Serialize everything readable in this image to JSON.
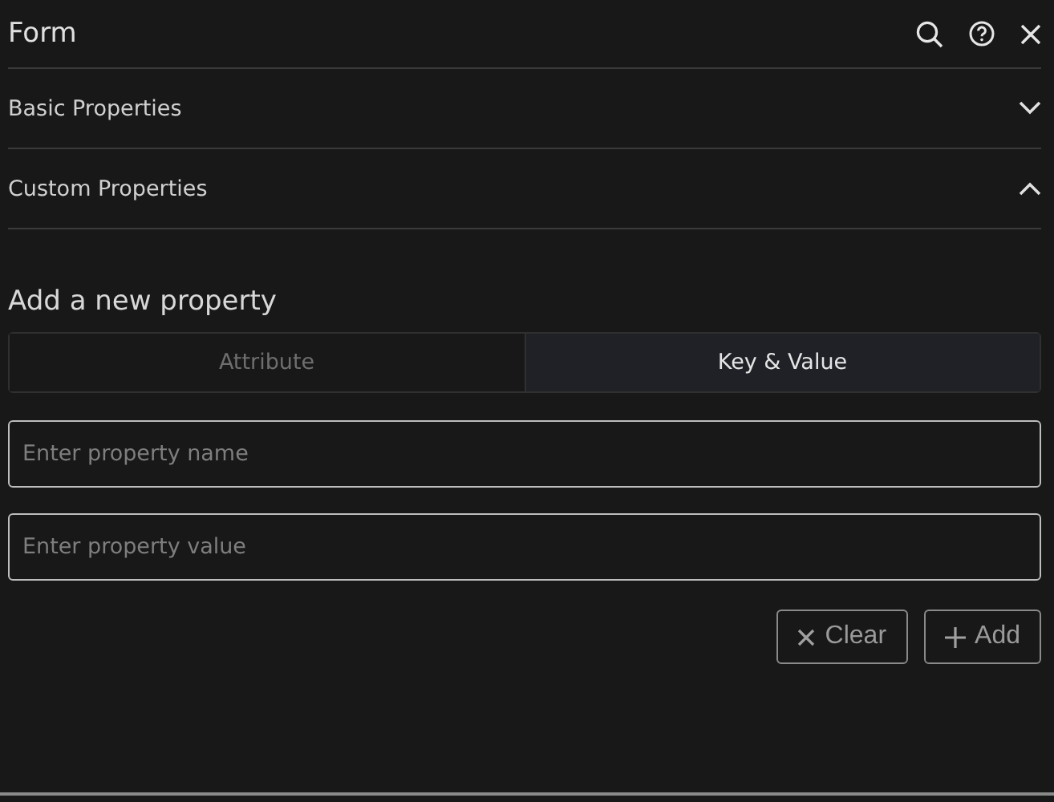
{
  "window": {
    "title": "Form"
  },
  "sections": [
    {
      "label": "Basic Properties",
      "expanded": false
    },
    {
      "label": "Custom Properties",
      "expanded": true
    }
  ],
  "add_property": {
    "heading": "Add a new property",
    "tabs": [
      {
        "label": "Attribute",
        "selected": false
      },
      {
        "label": "Key & Value",
        "selected": true
      }
    ],
    "fields": [
      {
        "placeholder": "Enter property name"
      },
      {
        "placeholder": "Enter property value"
      }
    ],
    "buttons": [
      {
        "kind": "clear",
        "label": "Clear"
      },
      {
        "kind": "add",
        "label": "Add"
      }
    ]
  }
}
